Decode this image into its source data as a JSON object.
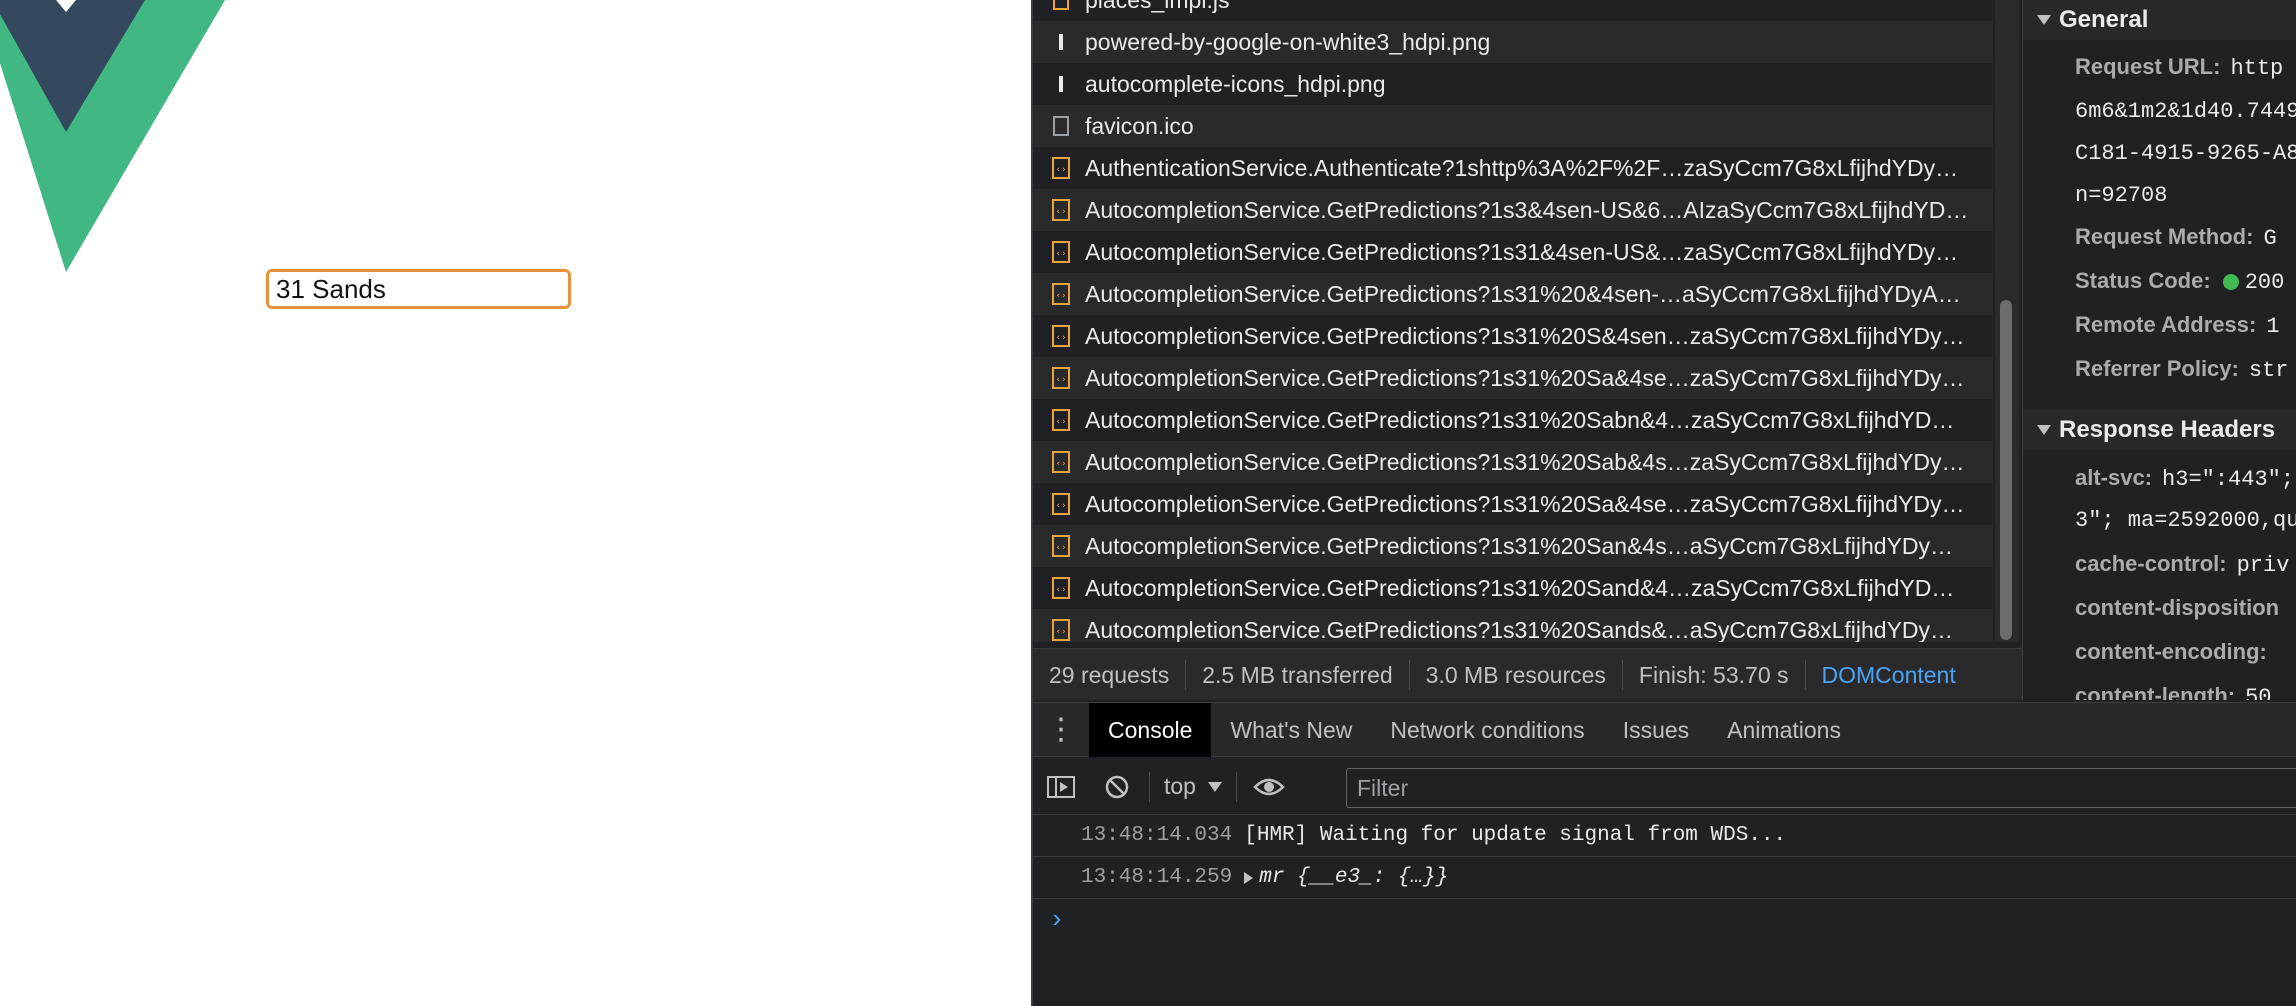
{
  "page": {
    "address_value": "31 Sands"
  },
  "network": {
    "requests": [
      {
        "name": "places_impl.js",
        "icon": "js-file-icon"
      },
      {
        "name": "powered-by-google-on-white3_hdpi.png",
        "icon": "image-file-icon"
      },
      {
        "name": "autocomplete-icons_hdpi.png",
        "icon": "image-file-icon"
      },
      {
        "name": "favicon.ico",
        "icon": "blank-file-icon"
      },
      {
        "name": "AuthenticationService.Authenticate?1shttp%3A%2F%2F…zaSyCcm7G8xLfijhdYDy…",
        "icon": "xhr-file-icon"
      },
      {
        "name": "AutocompletionService.GetPredictions?1s3&4sen-US&6…AIzaSyCcm7G8xLfijhdYD…",
        "icon": "xhr-file-icon"
      },
      {
        "name": "AutocompletionService.GetPredictions?1s31&4sen-US&…zaSyCcm7G8xLfijhdYDy…",
        "icon": "xhr-file-icon"
      },
      {
        "name": "AutocompletionService.GetPredictions?1s31%20&4sen-…aSyCcm7G8xLfijhdYDyA…",
        "icon": "xhr-file-icon"
      },
      {
        "name": "AutocompletionService.GetPredictions?1s31%20S&4sen…zaSyCcm7G8xLfijhdYDy…",
        "icon": "xhr-file-icon"
      },
      {
        "name": "AutocompletionService.GetPredictions?1s31%20Sa&4se…zaSyCcm7G8xLfijhdYDy…",
        "icon": "xhr-file-icon"
      },
      {
        "name": "AutocompletionService.GetPredictions?1s31%20Sabn&4…zaSyCcm7G8xLfijhdYD…",
        "icon": "xhr-file-icon"
      },
      {
        "name": "AutocompletionService.GetPredictions?1s31%20Sab&4s…zaSyCcm7G8xLfijhdYDy…",
        "icon": "xhr-file-icon"
      },
      {
        "name": "AutocompletionService.GetPredictions?1s31%20Sa&4se…zaSyCcm7G8xLfijhdYDy…",
        "icon": "xhr-file-icon"
      },
      {
        "name": "AutocompletionService.GetPredictions?1s31%20San&4s…aSyCcm7G8xLfijhdYDy…",
        "icon": "xhr-file-icon"
      },
      {
        "name": "AutocompletionService.GetPredictions?1s31%20Sand&4…zaSyCcm7G8xLfijhdYD…",
        "icon": "xhr-file-icon"
      },
      {
        "name": "AutocompletionService.GetPredictions?1s31%20Sands&…aSyCcm7G8xLfijhdYDy…",
        "icon": "xhr-file-icon"
      }
    ],
    "status": {
      "requests": "29 requests",
      "transferred": "2.5 MB transferred",
      "resources": "3.0 MB resources",
      "finish": "Finish: 53.70 s",
      "domcontent": "DOMContent"
    }
  },
  "headers": {
    "general_title": "General",
    "request_url_key": "Request URL:",
    "request_url_val": "http",
    "request_url_cont1": "6m6&1m2&1d40.7449",
    "request_url_cont2": "C181-4915-9265-A8",
    "request_url_cont3": "n=92708",
    "request_method_key": "Request Method:",
    "request_method_val": "G",
    "status_code_key": "Status Code:",
    "status_code_val": "200",
    "remote_address_key": "Remote Address:",
    "remote_address_val": "1",
    "referrer_policy_key": "Referrer Policy:",
    "referrer_policy_val": "str",
    "response_title": "Response Headers",
    "alt_svc_key": "alt-svc:",
    "alt_svc_val": "h3=\":443\";",
    "alt_svc_cont": "3\"; ma=2592000,qu",
    "cache_control_key": "cache-control:",
    "cache_control_val": "priv",
    "content_disposition_key": "content-disposition",
    "content_encoding_key": "content-encoding:",
    "content_length_key": "content-length:",
    "content_length_val": "50"
  },
  "drawer": {
    "tabs": [
      "Console",
      "What's New",
      "Network conditions",
      "Issues",
      "Animations"
    ],
    "active_tab": "Console",
    "context": "top",
    "filter_placeholder": "Filter",
    "messages": [
      {
        "time": "13:48:14.034",
        "text": "[HMR] Waiting for update signal from WDS..."
      },
      {
        "time": "13:48:14.259",
        "text": "mr {__e3_: {…}}"
      }
    ],
    "prompt": "›"
  },
  "colors": {
    "input_border": "#e8913a",
    "vue_green": "#41b883",
    "vue_dark": "#35495e",
    "link_blue": "#4aa3f7",
    "status_green": "#3fb950"
  }
}
